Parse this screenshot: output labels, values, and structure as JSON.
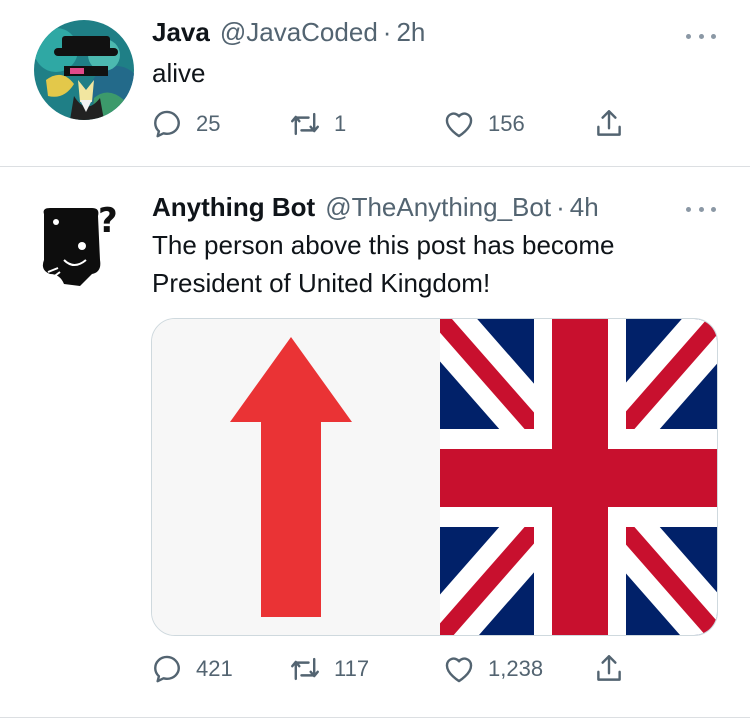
{
  "tweets": [
    {
      "display_name": "Java",
      "handle": "@JavaCoded",
      "separator": "·",
      "time": "2h",
      "text": "alive",
      "reply_count": "25",
      "retweet_count": "1",
      "like_count": "156"
    },
    {
      "display_name": "Anything Bot",
      "handle": "@TheAnything_Bot",
      "separator": "·",
      "time": "4h",
      "text": "The person above this post has become President of United Kingdom!",
      "reply_count": "421",
      "retweet_count": "117",
      "like_count": "1,238",
      "media": [
        "up-arrow",
        "union-jack-flag"
      ]
    }
  ],
  "icons": [
    "more-icon",
    "reply-icon",
    "retweet-icon",
    "like-icon",
    "share-icon"
  ],
  "colors": {
    "text_primary": "#0f1419",
    "text_secondary": "#536471",
    "arrow_red": "#ea3335",
    "flag_blue": "#012169",
    "flag_red": "#c8102e"
  }
}
